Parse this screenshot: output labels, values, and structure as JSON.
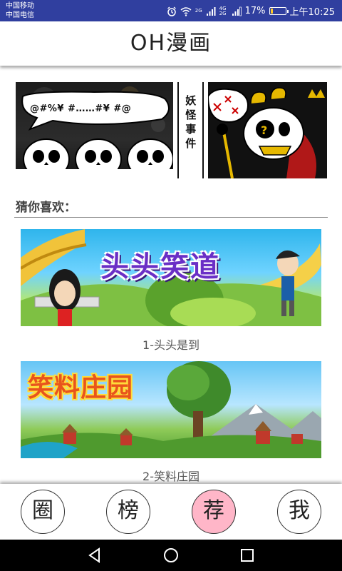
{
  "status_bar": {
    "carrier_1": "中国移动",
    "carrier_2": "中国电信",
    "network_1": "2G",
    "network_2": "4G 2G",
    "battery": "17%",
    "battery_level": 0.17,
    "time": "上午10:25",
    "background": "#303f9f"
  },
  "header": {
    "title": "OH漫画"
  },
  "banner": {
    "bubble_text": "@#%¥ #……#¥ #@",
    "vertical_text": "妖怪事件"
  },
  "section": {
    "title": "猜你喜欢："
  },
  "recommendations": [
    {
      "banner_word": "头头笑道",
      "caption": "1-头头是到"
    },
    {
      "banner_word": "笑料庄园",
      "caption": "2-笑料庄园"
    }
  ],
  "bottom_nav": {
    "items": [
      {
        "label": "圈"
      },
      {
        "label": "榜"
      },
      {
        "label": "荐",
        "active": true
      },
      {
        "label": "我"
      }
    ],
    "active_color": "#ffb6c8"
  },
  "system_nav": {
    "icons": [
      "back-icon",
      "home-icon",
      "recents-icon"
    ]
  }
}
